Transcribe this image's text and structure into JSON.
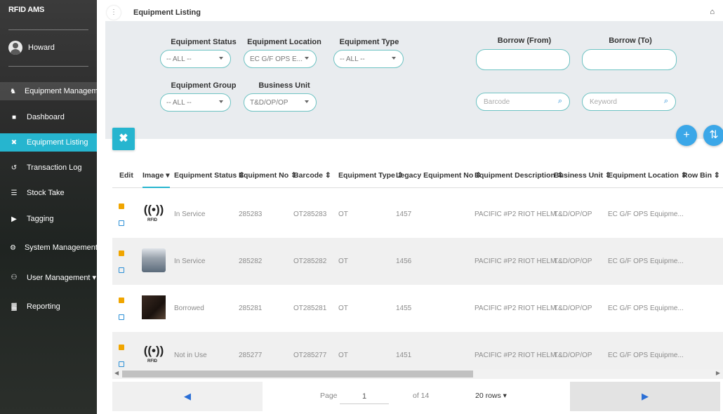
{
  "app": {
    "title": "RFID AMS",
    "user": "Howard"
  },
  "sidebar": {
    "items": [
      {
        "label": "Equipment Management",
        "icon": "equipment-icon",
        "glyph": "♞"
      },
      {
        "label": "Dashboard",
        "icon": "dashboard-icon",
        "glyph": "■"
      },
      {
        "label": "Equipment Listing",
        "icon": "listing-icon",
        "glyph": "✖"
      },
      {
        "label": "Transaction Log",
        "icon": "transaction-icon",
        "glyph": "↺"
      },
      {
        "label": "Stock Take",
        "icon": "stock-icon",
        "glyph": "☰"
      },
      {
        "label": "Tagging",
        "icon": "tag-icon",
        "glyph": "▶"
      },
      {
        "label": "System Management",
        "icon": "gear-icon",
        "glyph": "⚙"
      },
      {
        "label": "User Management ▾",
        "icon": "users-icon",
        "glyph": "⚇"
      },
      {
        "label": "Reporting",
        "icon": "report-icon",
        "glyph": "▓"
      }
    ]
  },
  "header": {
    "title": "Equipment Listing",
    "menu_glyph": "⋮",
    "home_glyph": "⌂"
  },
  "filters": {
    "status_label": "Equipment Status",
    "status_value": "-- ALL --",
    "location_label": "Equipment Location",
    "location_value": "EC G/F OPS E...",
    "type_label": "Equipment Type",
    "type_value": "-- ALL --",
    "borrow_from_label": "Borrow (From)",
    "borrow_to_label": "Borrow (To)",
    "group_label": "Equipment Group",
    "group_value": "-- ALL --",
    "unit_label": "Business Unit",
    "unit_value": "T&D/OP/OP",
    "barcode_placeholder": "Barcode",
    "keyword_placeholder": "Keyword",
    "search_glyph": "⌕"
  },
  "actions": {
    "tools_glyph": "✖",
    "add_glyph": "+",
    "sort_glyph": "⇅"
  },
  "table": {
    "columns": [
      "Edit",
      "Image ▾",
      "Equipment Status ⇕",
      "Equipment No ⇕",
      "Barcode ⇕",
      "Equipment Type ⇕",
      "Legacy Equipment No ⇕",
      "Equipment Description ⇕",
      "Business Unit ⇕",
      "Equipment Location ⇕",
      "Row Bin ⇕"
    ],
    "rows": [
      {
        "image": "rfid",
        "status": "In Service",
        "equipment_no": "285283",
        "barcode": "OT285283",
        "type": "OT",
        "legacy_no": "1457",
        "description": "PACIFIC #P2 RIOT HELM...",
        "unit": "T&D/OP/OP",
        "location": "EC G/F OPS Equipme..."
      },
      {
        "image": "printer",
        "status": "In Service",
        "equipment_no": "285282",
        "barcode": "OT285282",
        "type": "OT",
        "legacy_no": "1456",
        "description": "PACIFIC #P2 RIOT HELM...",
        "unit": "T&D/OP/OP",
        "location": "EC G/F OPS Equipme..."
      },
      {
        "image": "photo",
        "status": "Borrowed",
        "equipment_no": "285281",
        "barcode": "OT285281",
        "type": "OT",
        "legacy_no": "1455",
        "description": "PACIFIC #P2 RIOT HELM...",
        "unit": "T&D/OP/OP",
        "location": "EC G/F OPS Equipme..."
      },
      {
        "image": "rfid",
        "status": "Not in Use",
        "equipment_no": "285277",
        "barcode": "OT285277",
        "type": "OT",
        "legacy_no": "1451",
        "description": "PACIFIC #P2 RIOT HELM...",
        "unit": "T&D/OP/OP",
        "location": "EC G/F OPS Equipme..."
      }
    ],
    "rfid_glyph": "((•))",
    "rfid_text": "RFID"
  },
  "pagination": {
    "prev_glyph": "◀",
    "next_glyph": "▶",
    "page_label": "Page",
    "page_value": "1",
    "of_label": "of 14",
    "rows_label": "20 rows ▾"
  },
  "colors": {
    "accent": "#26b5cf",
    "primary_blue": "#3ba7e8",
    "border": "#6ec3c3",
    "alt_row": "#f0f0f0"
  }
}
